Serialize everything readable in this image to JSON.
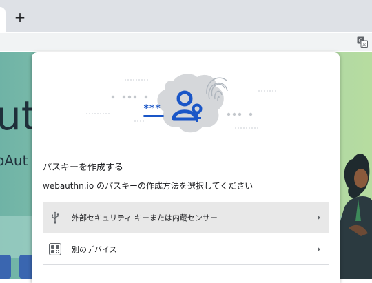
{
  "browser": {
    "new_tab_label": "+"
  },
  "page": {
    "heading_fragment": "ut",
    "subheading_fragment": "oAut"
  },
  "dialog": {
    "title": "パスキーを作成する",
    "description": "webauthn.io のパスキーの作成方法を選択してください",
    "options": [
      {
        "label": "外部セキュリティ キーまたは内蔵センサー",
        "icon": "usb-icon"
      },
      {
        "label": "別のデバイス",
        "icon": "qr-code-icon"
      }
    ]
  },
  "colors": {
    "accent": "#1a56c7",
    "hover_row": "#e8e8e8"
  }
}
